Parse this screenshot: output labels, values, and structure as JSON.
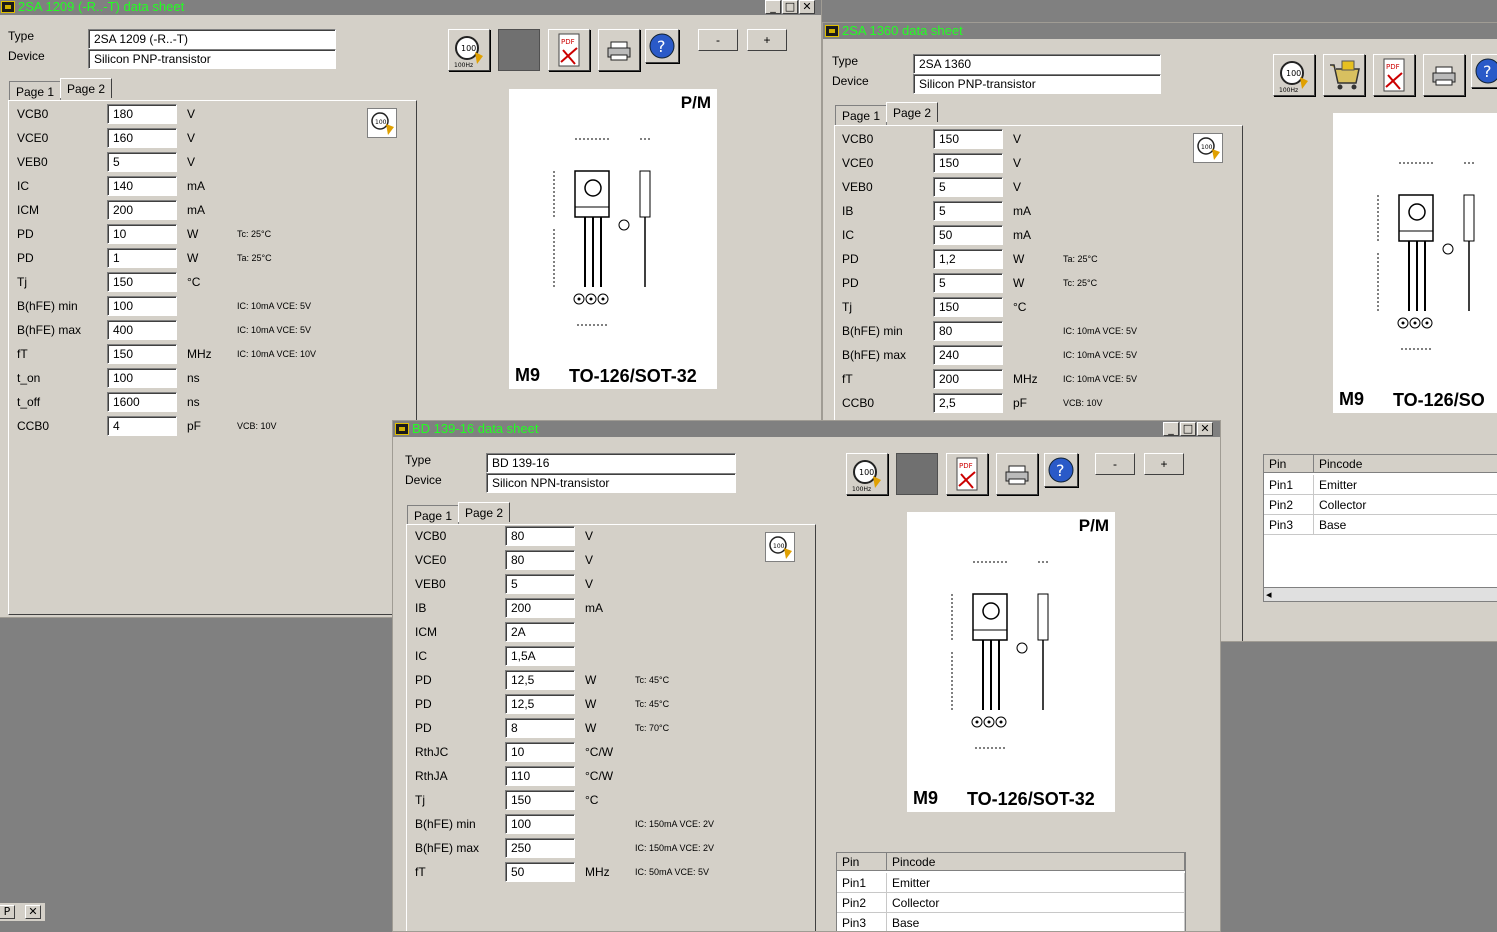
{
  "window1": {
    "title": "2SA 1209 (-R..-T) data sheet",
    "type_label": "Type",
    "type_value": "2SA 1209 (-R..-T)",
    "device_label": "Device",
    "device_value": "Silicon PNP-transistor",
    "tab1": "Page 1",
    "tab2": "Page 2",
    "minus_label": "-",
    "plus_label": "+",
    "params": [
      {
        "name": "VCB0",
        "value": "180",
        "unit": "V",
        "note": ""
      },
      {
        "name": "VCE0",
        "value": "160",
        "unit": "V",
        "note": ""
      },
      {
        "name": "VEB0",
        "value": "5",
        "unit": "V",
        "note": ""
      },
      {
        "name": "IC",
        "value": "140",
        "unit": "mA",
        "note": ""
      },
      {
        "name": "ICM",
        "value": "200",
        "unit": "mA",
        "note": ""
      },
      {
        "name": "PD",
        "value": "10",
        "unit": "W",
        "note": "Tc: 25°C"
      },
      {
        "name": "PD",
        "value": "1",
        "unit": "W",
        "note": "Ta: 25°C"
      },
      {
        "name": "Tj",
        "value": "150",
        "unit": "°C",
        "note": ""
      },
      {
        "name": "B(hFE) min",
        "value": "100",
        "unit": "",
        "note": "IC: 10mA VCE: 5V"
      },
      {
        "name": "B(hFE) max",
        "value": "400",
        "unit": "",
        "note": "IC: 10mA VCE: 5V"
      },
      {
        "name": "fT",
        "value": "150",
        "unit": "MHz",
        "note": "IC: 10mA VCE: 10V"
      },
      {
        "name": "t_on",
        "value": "100",
        "unit": "ns",
        "note": ""
      },
      {
        "name": "t_off",
        "value": "1600",
        "unit": "ns",
        "note": ""
      },
      {
        "name": "CCB0",
        "value": "4",
        "unit": "pF",
        "note": "VCB: 10V"
      }
    ],
    "package": {
      "pm": "P/M",
      "code": "M9",
      "name": "TO-126/SOT-32"
    }
  },
  "window2": {
    "title": "2SA 1360 data sheet",
    "type_label": "Type",
    "type_value": "2SA 1360",
    "device_label": "Device",
    "device_value": "Silicon PNP-transistor",
    "tab1": "Page 1",
    "tab2": "Page 2",
    "params": [
      {
        "name": "VCB0",
        "value": "150",
        "unit": "V",
        "note": ""
      },
      {
        "name": "VCE0",
        "value": "150",
        "unit": "V",
        "note": ""
      },
      {
        "name": "VEB0",
        "value": "5",
        "unit": "V",
        "note": ""
      },
      {
        "name": "IB",
        "value": "5",
        "unit": "mA",
        "note": ""
      },
      {
        "name": "IC",
        "value": "50",
        "unit": "mA",
        "note": ""
      },
      {
        "name": "PD",
        "value": "1,2",
        "unit": "W",
        "note": "Ta: 25°C"
      },
      {
        "name": "PD",
        "value": "5",
        "unit": "W",
        "note": "Tc: 25°C"
      },
      {
        "name": "Tj",
        "value": "150",
        "unit": "°C",
        "note": ""
      },
      {
        "name": "B(hFE) min",
        "value": "80",
        "unit": "",
        "note": "IC: 10mA VCE: 5V"
      },
      {
        "name": "B(hFE) max",
        "value": "240",
        "unit": "",
        "note": "IC: 10mA VCE: 5V"
      },
      {
        "name": "fT",
        "value": "200",
        "unit": "MHz",
        "note": "IC: 10mA VCE: 5V"
      },
      {
        "name": "CCB0",
        "value": "2,5",
        "unit": "pF",
        "note": "VCB: 10V"
      }
    ],
    "package": {
      "code": "M9",
      "name": "TO-126/SO"
    },
    "pins": {
      "col1": "Pin",
      "col2": "Pincode",
      "rows": [
        [
          "Pin1",
          "Emitter"
        ],
        [
          "Pin2",
          "Collector"
        ],
        [
          "Pin3",
          "Base"
        ]
      ]
    }
  },
  "window3": {
    "title": "BD 139-16 data sheet",
    "type_label": "Type",
    "type_value": "BD 139-16",
    "device_label": "Device",
    "device_value": "Silicon NPN-transistor",
    "tab1": "Page 1",
    "tab2": "Page 2",
    "minus_label": "-",
    "plus_label": "+",
    "params": [
      {
        "name": "VCB0",
        "value": "80",
        "unit": "V",
        "note": ""
      },
      {
        "name": "VCE0",
        "value": "80",
        "unit": "V",
        "note": ""
      },
      {
        "name": "VEB0",
        "value": "5",
        "unit": "V",
        "note": ""
      },
      {
        "name": "IB",
        "value": "200",
        "unit": "mA",
        "note": ""
      },
      {
        "name": "ICM",
        "value": "2A",
        "unit": "",
        "note": ""
      },
      {
        "name": "IC",
        "value": "1,5A",
        "unit": "",
        "note": ""
      },
      {
        "name": "PD",
        "value": "12,5",
        "unit": "W",
        "note": "Tc: 45°C"
      },
      {
        "name": "PD",
        "value": "12,5",
        "unit": "W",
        "note": "Tc: 45°C"
      },
      {
        "name": "PD",
        "value": "8",
        "unit": "W",
        "note": "Tc: 70°C"
      },
      {
        "name": "RthJC",
        "value": "10",
        "unit": "°C/W",
        "note": ""
      },
      {
        "name": "RthJA",
        "value": "110",
        "unit": "°C/W",
        "note": ""
      },
      {
        "name": "Tj",
        "value": "150",
        "unit": "°C",
        "note": ""
      },
      {
        "name": "B(hFE) min",
        "value": "100",
        "unit": "",
        "note": "IC: 150mA VCE: 2V"
      },
      {
        "name": "B(hFE) max",
        "value": "250",
        "unit": "",
        "note": "IC: 150mA VCE: 2V"
      },
      {
        "name": "fT",
        "value": "50",
        "unit": "MHz",
        "note": "IC: 50mA VCE: 5V"
      }
    ],
    "package": {
      "pm": "P/M",
      "code": "M9",
      "name": "TO-126/SOT-32"
    },
    "pins": {
      "col1": "Pin",
      "col2": "Pincode",
      "rows": [
        [
          "Pin1",
          "Emitter"
        ],
        [
          "Pin2",
          "Collector"
        ],
        [
          "Pin3",
          "Base"
        ]
      ]
    }
  },
  "toolbar_icons": [
    "calc-100ohm-icon",
    "blank-icon",
    "pdf-icon",
    "printer-icon",
    "help-icon"
  ],
  "toolbar_icons_w2": [
    "calc-100ohm-icon",
    "shopping-cart-icon",
    "pdf-icon",
    "printer-icon",
    "help-icon"
  ],
  "icon_texts": {
    "pdf": "PDF",
    "help": "?",
    "ohm": "100",
    "ohm_sub": "100Hz"
  },
  "window_controls": {
    "minimize": "_",
    "maximize": "□",
    "close": "✕"
  },
  "minimized_bar": {
    "p": "P",
    "close": "✕"
  }
}
